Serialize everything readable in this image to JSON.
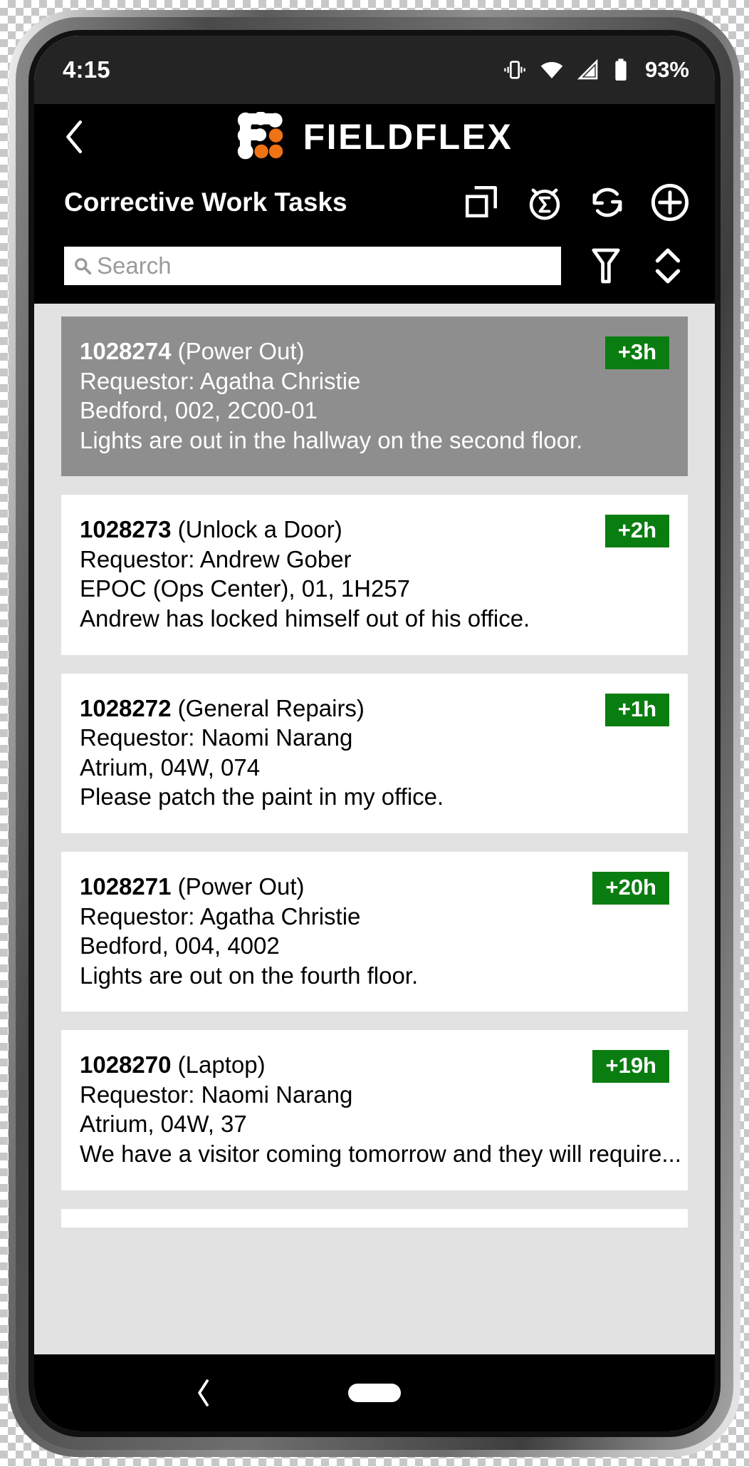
{
  "status_bar": {
    "time": "4:15",
    "battery_percent": "93%",
    "icons": [
      "vibrate-icon",
      "wifi-icon",
      "cell-signal-icon",
      "battery-icon"
    ]
  },
  "app_bar": {
    "back_icon": "back-chevron-icon",
    "brand_name": "FIELDFLEX",
    "brand_logo": "fieldflex-logo-icon",
    "page_title": "Corrective Work Tasks",
    "actions": [
      {
        "name": "duplicate-icon",
        "label": "Duplicate"
      },
      {
        "name": "alarm-sigma-icon",
        "label": "Totals"
      },
      {
        "name": "refresh-icon",
        "label": "Refresh"
      },
      {
        "name": "add-icon",
        "label": "Add"
      }
    ]
  },
  "search": {
    "placeholder": "Search",
    "value": "",
    "search_icon": "search-icon",
    "filter_icon": "filter-funnel-icon",
    "sort_icon": "sort-updown-icon"
  },
  "colors": {
    "badge_green": "#0a7d10",
    "selected_gray": "#8e8e8e",
    "brand_orange": "#ef7215",
    "app_black": "#000000",
    "list_background": "#e2e2e2"
  },
  "tasks": [
    {
      "id": "1028274",
      "type": "(Power Out)",
      "requestor": "Requestor: Agatha Christie",
      "location": "Bedford, 002, 2C00-01",
      "description": "Lights are out in the hallway on the second floor.",
      "badge": "+3h",
      "selected": true
    },
    {
      "id": "1028273",
      "type": "(Unlock a Door)",
      "requestor": "Requestor: Andrew Gober",
      "location": "EPOC (Ops Center), 01, 1H257",
      "description": "Andrew has locked himself out of his office.",
      "badge": "+2h",
      "selected": false
    },
    {
      "id": "1028272",
      "type": "(General Repairs)",
      "requestor": "Requestor: Naomi Narang",
      "location": "Atrium, 04W, 074",
      "description": "Please patch the paint in my office.",
      "badge": "+1h",
      "selected": false
    },
    {
      "id": "1028271",
      "type": "(Power Out)",
      "requestor": "Requestor: Agatha Christie",
      "location": "Bedford, 004, 4002",
      "description": "Lights are out on the fourth floor.",
      "badge": "+20h",
      "selected": false
    },
    {
      "id": "1028270",
      "type": "(Laptop)",
      "requestor": "Requestor: Naomi Narang",
      "location": "Atrium, 04W, 37",
      "description": "We have a visitor coming tomorrow and they will require...",
      "badge": "+19h",
      "selected": false
    }
  ],
  "nav_bar": {
    "back_icon": "nav-back-icon",
    "home_icon": "nav-home-pill-icon"
  }
}
